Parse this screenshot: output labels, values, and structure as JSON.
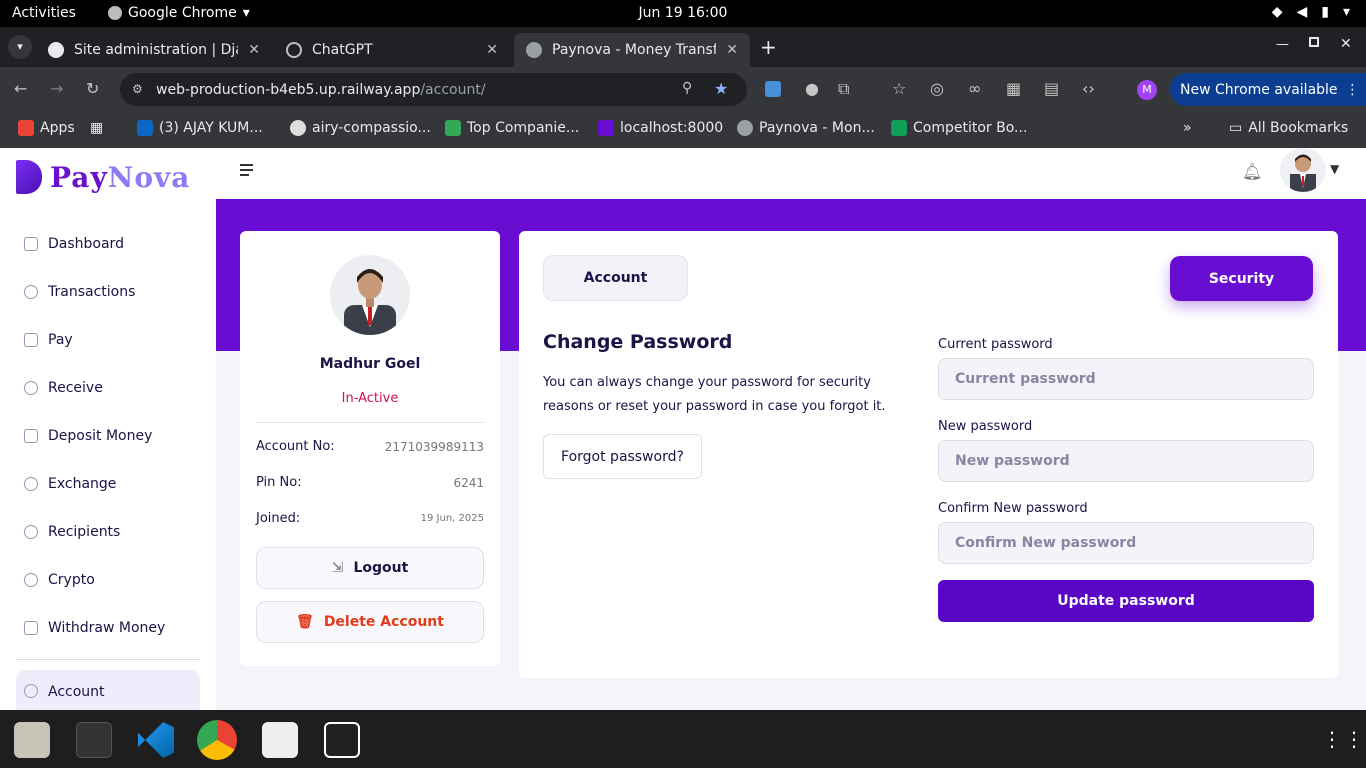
{
  "system": {
    "activities": "Activities",
    "app_name": "Google Chrome",
    "clock": "Jun 19  16:00"
  },
  "tabs": [
    {
      "title": "Site administration | Django",
      "fav_color": "#e8eaed"
    },
    {
      "title": "ChatGPT",
      "fav_color": "#9aa0a6"
    },
    {
      "title": "Paynova - Money Transfer",
      "fav_color": "#9aa0a6"
    }
  ],
  "omnibox": {
    "url_host": "web-production-b4eb5.up.railway.app",
    "url_path": "/account/"
  },
  "toolbar": {
    "new_chrome": "New Chrome available",
    "profile_initial": "M"
  },
  "bookmarks": [
    "Apps",
    "(3) AJAY KUM...",
    "airy-compassio...",
    "Top Companie...",
    "localhost:8000",
    "Paynova - Mon...",
    "Competitor Bo...",
    "All Bookmarks"
  ],
  "brand": {
    "pay": "Pay",
    "nova": "Nova"
  },
  "nav": [
    "Dashboard",
    "Transactions",
    "Pay",
    "Receive",
    "Deposit Money",
    "Exchange",
    "Recipients",
    "Crypto",
    "Withdraw Money",
    "Account"
  ],
  "profile": {
    "name": "Madhur Goel",
    "status": "In-Active",
    "account_label": "Account No:",
    "account_value": "2171039989113",
    "pin_label": "Pin No:",
    "pin_value": "6241",
    "joined_label": "Joined:",
    "joined_value": "19 Jun, 2025",
    "logout": "Logout",
    "delete": "Delete Account"
  },
  "tabs_main": {
    "account": "Account",
    "security": "Security"
  },
  "change_password": {
    "title": "Change Password",
    "description": "You can always change your password for security reasons or reset your password in case you forgot it.",
    "forgot": "Forgot password?",
    "current_label": "Current password",
    "current_placeholder": "Current password",
    "new_label": "New password",
    "new_placeholder": "New password",
    "confirm_label": "Confirm New password",
    "confirm_placeholder": "Confirm New password",
    "update": "Update password"
  },
  "colors": {
    "brand": "#6a0dd3",
    "danger": "#e23b1a",
    "status_red": "#d0104c"
  }
}
